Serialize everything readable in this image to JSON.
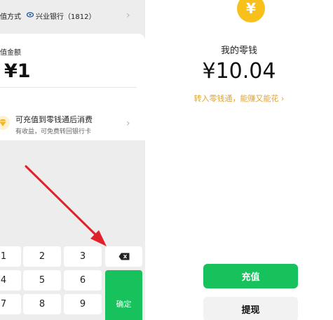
{
  "topup": {
    "payment_method_label": "值方式",
    "bank_name": "兴业银行（1812）",
    "amount_label": "值金额",
    "amount_value": "¥1",
    "tip_title": "可充值到零钱通后消费",
    "tip_subtitle": "有收益，可免费转回银行卡"
  },
  "keypad": {
    "keys": [
      "1",
      "2",
      "3",
      "4",
      "5",
      "6",
      "7",
      "8",
      "9"
    ],
    "confirm_label": "确定"
  },
  "wallet": {
    "coin_symbol": "¥",
    "title": "我的零钱",
    "balance": "¥10.04",
    "promo_text": "转入零钱通，能赚又能花 ›",
    "recharge_label": "充值",
    "withdraw_label": "提现"
  },
  "colors": {
    "accent_green": "#17c15b",
    "coin_yellow": "#f8c01a",
    "promo_orange": "#e0a433",
    "arrow_red": "#e0202a"
  }
}
